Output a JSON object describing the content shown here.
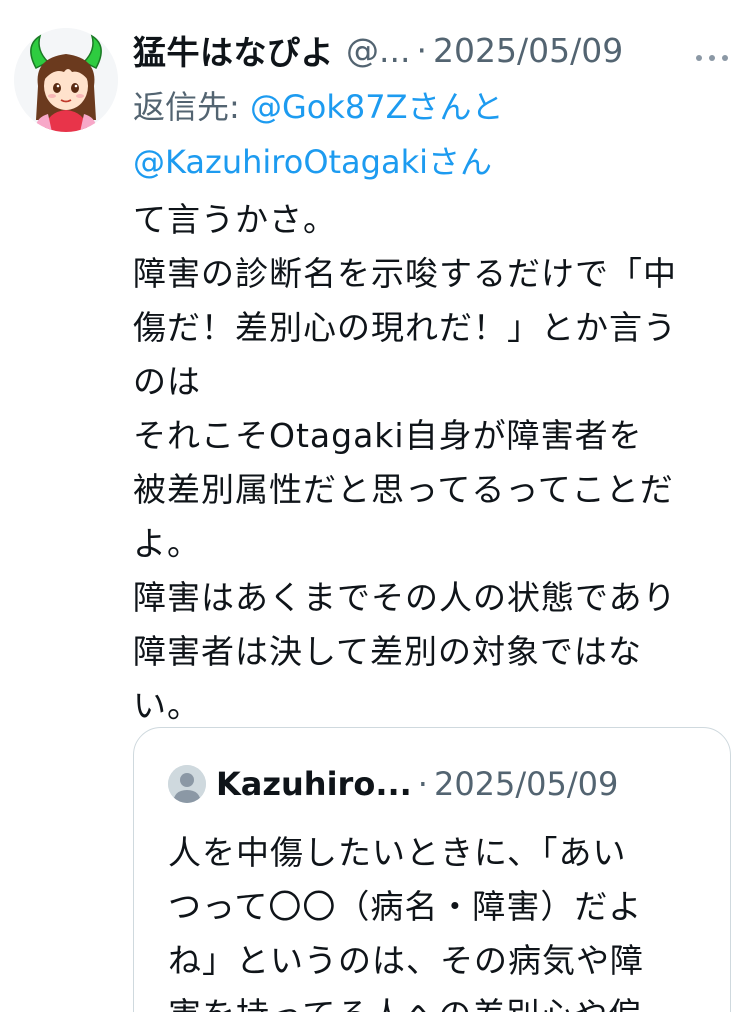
{
  "post": {
    "author_name": "猛牛はなぴよ",
    "author_handle": "@...",
    "separator": "·",
    "date": "2025/05/09",
    "reply_prefix": "返信先: ",
    "reply_mention_1": "@Gok87Z",
    "reply_joiner": "さんと",
    "reply_mention_2": "@KazuhiroOtagaki",
    "reply_suffix": "さん",
    "text": "て言うかさ。\n障害の診断名を示唆するだけで「中\n傷だ！差別心の現れだ！」とか言う\nのは\nそれこそOtagaki自身が障害者を\n被差別属性だと思ってるってことだ\nよ。\n障害はあくまでその人の状態であり\n障害者は決して差別の対象ではな\nい。"
  },
  "quote": {
    "author_name": "Kazuhiro...",
    "separator": "·",
    "date": "2025/05/09",
    "text": "人を中傷したいときに、「あい\nつって〇〇（病名・障害）だよ\nね」というのは、その病気や障\n害を持ってる人への差別心や偏"
  },
  "icons": {
    "more": "more-horizontal-icon",
    "avatar": "anime-girl-with-horns-avatar",
    "quote_avatar": "default-user-avatar"
  },
  "colors": {
    "text": "#0f1419",
    "secondary": "#536471",
    "link": "#1d9bf0",
    "border": "#cfd9de"
  }
}
